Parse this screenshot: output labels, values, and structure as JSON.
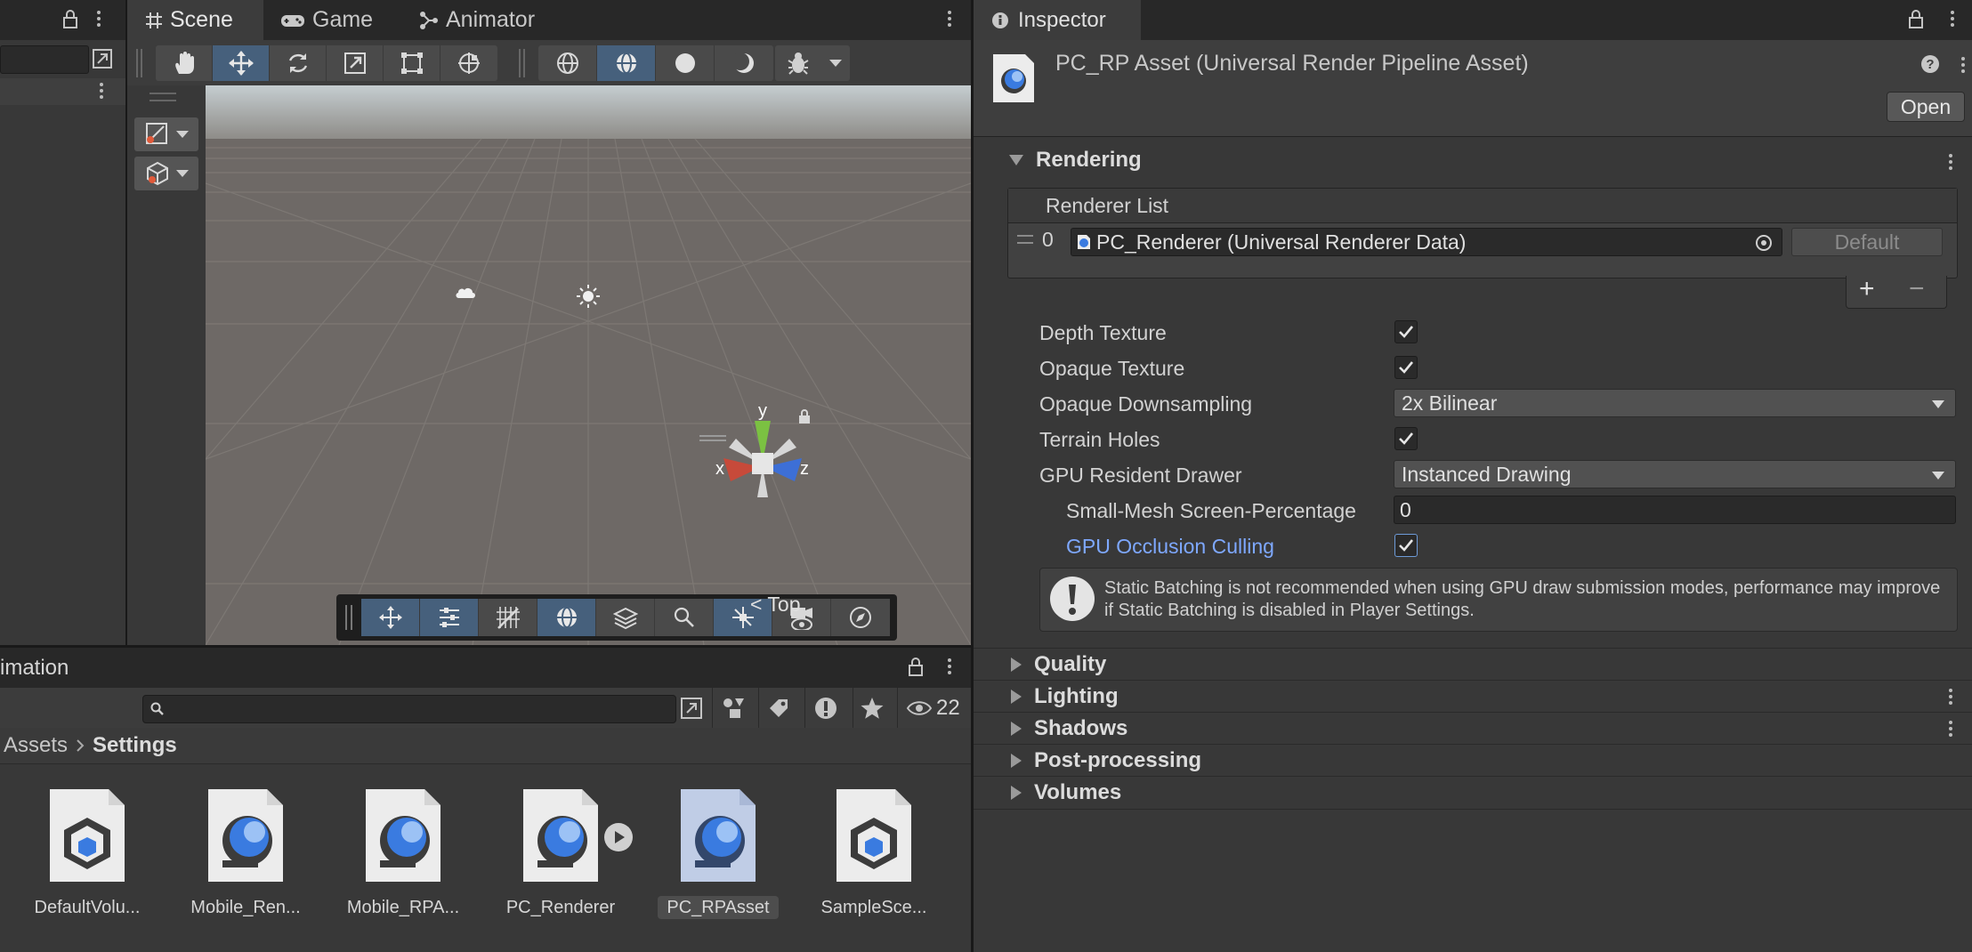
{
  "scene_tabs": [
    {
      "label": "Scene",
      "icon": "grid-hash-icon"
    },
    {
      "label": "Game",
      "icon": "gamepad-icon"
    },
    {
      "label": "Animator",
      "icon": "animator-icon"
    }
  ],
  "scene": {
    "view_label": "< Top",
    "gizmo_axes": {
      "x": "x",
      "y": "y",
      "z": "z"
    }
  },
  "project": {
    "tab_label": "imation",
    "visible_count": "22",
    "breadcrumb": [
      "Assets",
      "Settings"
    ],
    "assets": [
      {
        "label": "DefaultVolu...",
        "icon": "volume-profile-icon",
        "selected": false
      },
      {
        "label": "Mobile_Ren...",
        "icon": "render-pipeline-icon",
        "selected": false
      },
      {
        "label": "Mobile_RPA...",
        "icon": "render-pipeline-icon",
        "selected": false
      },
      {
        "label": "PC_Renderer",
        "icon": "render-pipeline-icon",
        "selected": false
      },
      {
        "label": "PC_RPAsset",
        "icon": "render-pipeline-icon",
        "selected": true
      },
      {
        "label": "SampleSce...",
        "icon": "volume-profile-icon",
        "selected": false
      }
    ]
  },
  "inspector": {
    "tab_label": "Inspector",
    "asset_title": "PC_RP Asset (Universal Render Pipeline Asset)",
    "open_button": "Open",
    "rendering": {
      "title": "Rendering",
      "renderer_list_label": "Renderer List",
      "renderer_index": "0",
      "renderer_value": "PC_Renderer (Universal Renderer Data)",
      "default_button": "Default",
      "add_symbol": "+",
      "remove_symbol": "−",
      "props": {
        "depth_texture": {
          "label": "Depth Texture",
          "checked": true
        },
        "opaque_texture": {
          "label": "Opaque Texture",
          "checked": true
        },
        "opaque_downsampling": {
          "label": "Opaque Downsampling",
          "value": "2x Bilinear"
        },
        "terrain_holes": {
          "label": "Terrain Holes",
          "checked": true
        },
        "gpu_resident_drawer": {
          "label": "GPU Resident Drawer",
          "value": "Instanced Drawing"
        },
        "small_mesh": {
          "label": "Small-Mesh Screen-Percentage",
          "value": "0"
        },
        "gpu_occlusion": {
          "label": "GPU Occlusion Culling",
          "checked": true
        }
      },
      "warning": "Static Batching is not recommended when using GPU draw submission modes, performance may improve if Static Batching is disabled in Player Settings."
    },
    "sections": [
      "Quality",
      "Lighting",
      "Shadows",
      "Post-processing",
      "Volumes"
    ]
  },
  "colors": {
    "accent_blue": "#46607c",
    "link_blue": "#7ea8ff",
    "panel_bg": "#383838"
  }
}
